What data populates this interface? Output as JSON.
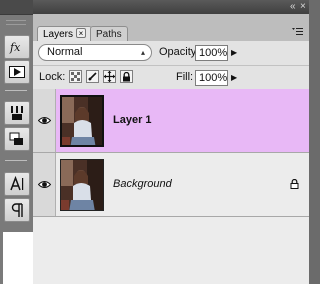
{
  "panel": {
    "tabs": [
      {
        "label": "Layers",
        "active": true
      },
      {
        "label": "Paths",
        "active": false
      }
    ],
    "close_glyph": "×",
    "titlebar_controls": {
      "collapse": "«",
      "close": "×"
    },
    "menu_icon": "menu-icon"
  },
  "blend_mode": {
    "value": "Normal"
  },
  "opacity": {
    "label": "Opacity:",
    "value": "100%"
  },
  "lock": {
    "label": "Lock:",
    "buttons": [
      "lock-transparent-icon",
      "lock-image-icon",
      "lock-position-icon",
      "lock-all-icon"
    ]
  },
  "fill": {
    "label": "Fill:",
    "value": "100%"
  },
  "layers": [
    {
      "name": "Layer 1",
      "selected": true,
      "visible": true,
      "locked": false
    },
    {
      "name": "Background",
      "selected": false,
      "visible": true,
      "locked": true
    }
  ],
  "colors": {
    "selected_row": "#e8b8f6",
    "panel_bg": "#d6d6d6"
  },
  "tools": [
    "fx-icon",
    "play-icon",
    "brush-icon",
    "clone-source-icon",
    "character-icon",
    "paragraph-icon"
  ]
}
